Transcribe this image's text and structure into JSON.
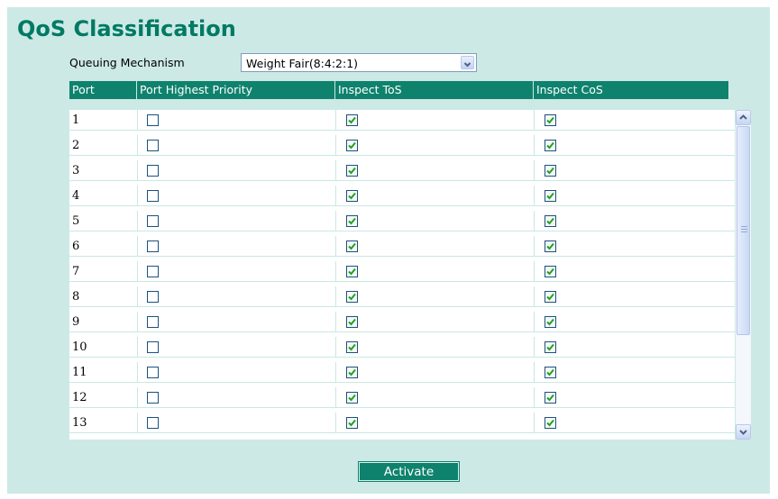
{
  "page": {
    "title": "QoS Classification"
  },
  "queuing": {
    "label": "Queuing Mechanism",
    "selected": "Weight Fair(8:4:2:1)"
  },
  "table": {
    "headers": [
      "Port",
      "Port Highest Priority",
      "Inspect ToS",
      "Inspect CoS"
    ],
    "rows": [
      {
        "port": "1",
        "highest_priority": false,
        "inspect_tos": true,
        "inspect_cos": true
      },
      {
        "port": "2",
        "highest_priority": false,
        "inspect_tos": true,
        "inspect_cos": true
      },
      {
        "port": "3",
        "highest_priority": false,
        "inspect_tos": true,
        "inspect_cos": true
      },
      {
        "port": "4",
        "highest_priority": false,
        "inspect_tos": true,
        "inspect_cos": true
      },
      {
        "port": "5",
        "highest_priority": false,
        "inspect_tos": true,
        "inspect_cos": true
      },
      {
        "port": "6",
        "highest_priority": false,
        "inspect_tos": true,
        "inspect_cos": true
      },
      {
        "port": "7",
        "highest_priority": false,
        "inspect_tos": true,
        "inspect_cos": true
      },
      {
        "port": "8",
        "highest_priority": false,
        "inspect_tos": true,
        "inspect_cos": true
      },
      {
        "port": "9",
        "highest_priority": false,
        "inspect_tos": true,
        "inspect_cos": true
      },
      {
        "port": "10",
        "highest_priority": false,
        "inspect_tos": true,
        "inspect_cos": true
      },
      {
        "port": "11",
        "highest_priority": false,
        "inspect_tos": true,
        "inspect_cos": true
      },
      {
        "port": "12",
        "highest_priority": false,
        "inspect_tos": true,
        "inspect_cos": true
      },
      {
        "port": "13",
        "highest_priority": false,
        "inspect_tos": true,
        "inspect_cos": true
      }
    ]
  },
  "actions": {
    "activate_label": "Activate"
  },
  "colors": {
    "accent": "#0f826d",
    "background": "#cce9e6",
    "title": "#007a63"
  },
  "icons": {
    "dropdown": "chevron-down-icon",
    "scroll_up": "arrow-up-icon",
    "scroll_down": "arrow-down-icon",
    "check": "check-icon"
  }
}
